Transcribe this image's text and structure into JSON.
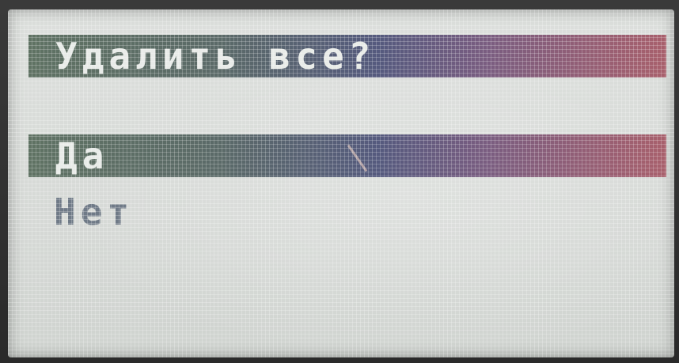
{
  "dialog": {
    "title": "Удалить все?",
    "options": [
      {
        "label": "Да",
        "selected": true
      },
      {
        "label": "Нет",
        "selected": false
      }
    ]
  },
  "colors": {
    "bar_start": "#5f7263",
    "bar_end": "#a8606c",
    "screen_bg": "#d6d9d6",
    "text_inverted": "#e8ebe8",
    "text_normal": "#6f7a87"
  }
}
